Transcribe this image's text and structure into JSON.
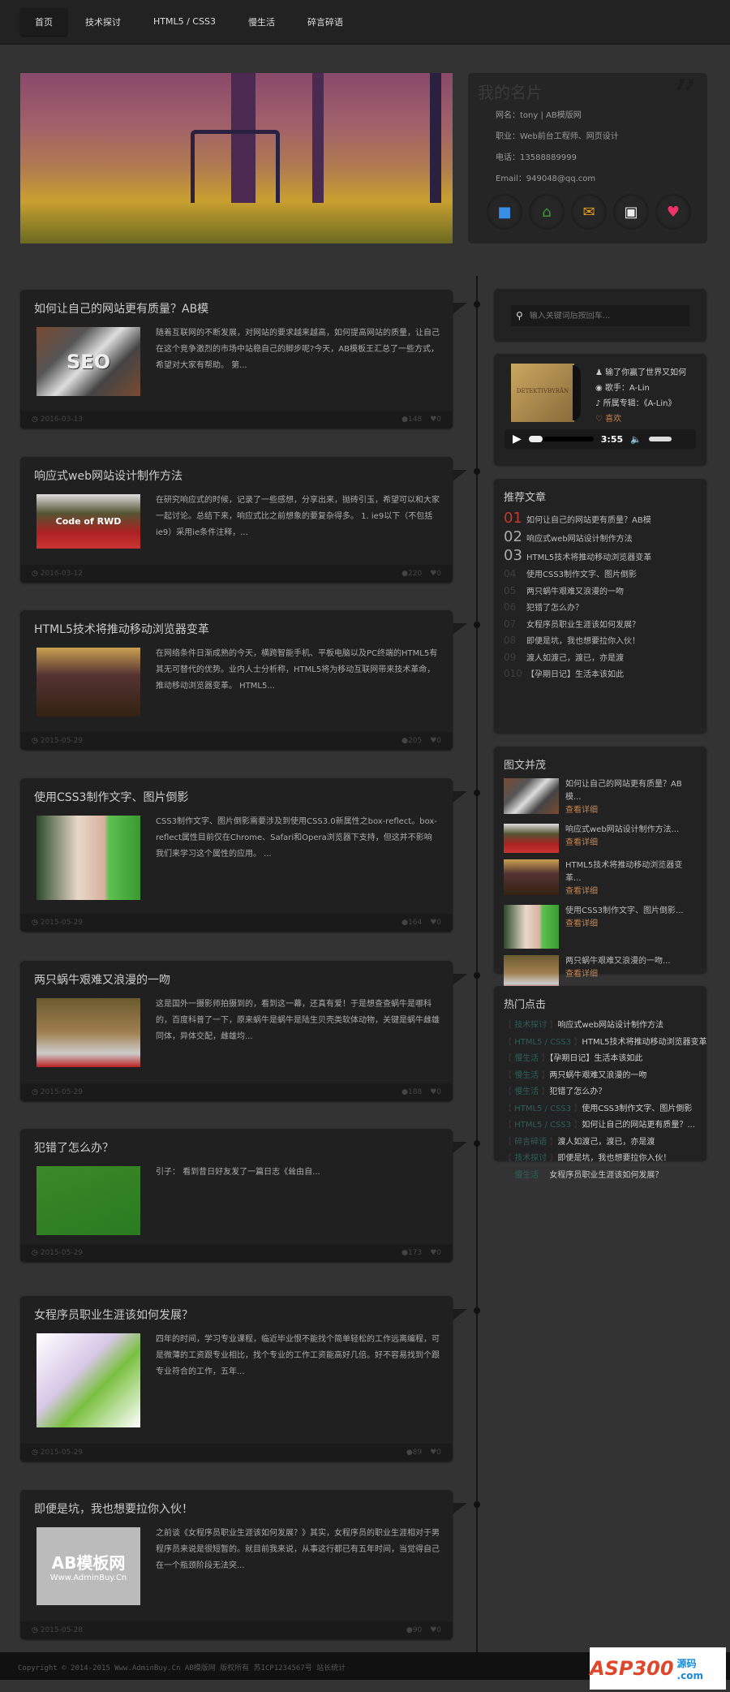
{
  "nav": {
    "items": [
      "首页",
      "技术探讨",
      "HTML5 / CSS3",
      "慢生活",
      "碎言碎语"
    ]
  },
  "profile": {
    "title": "我的名片",
    "quote": "”",
    "name": "网名：tony | AB模版网",
    "job": "职业：Web前台工程师、网页设计",
    "phone": "电话：13588889999",
    "email": "Email：949048@qq.com"
  },
  "posts": [
    {
      "title": "如何让自己的网站更有质量？AB模",
      "excerpt": "随着互联网的不断发展，对网站的要求越来越高，如何提高网站的质量，让自己在这个竞争激烈的市场中站稳自己的脚步呢?今天，AB模板王汇总了一些方式，希望对大家有帮助。 第...",
      "date": "2016-03-13",
      "comments": "148",
      "likes": "0",
      "thumb_text": "SEO"
    },
    {
      "title": "响应式web网站设计制作方法",
      "excerpt": "在研究响应式的时候，记录了一些感想，分享出来，抛砖引玉，希望可以和大家一起讨论。总结下来，响应式比之前想象的要复杂得多。 1. ie9以下（不包括ie9）采用ie条件注释，...",
      "date": "2016-03-12",
      "comments": "220",
      "likes": "0",
      "thumb_text": "Code of RWD"
    },
    {
      "title": "HTML5技术将推动移动浏览器变革",
      "excerpt": "在网络条件日渐成熟的今天，横跨智能手机、平板电脑以及PC终端的HTML5有其无可替代的优势。业内人士分析称，HTML5将为移动互联网带来技术革命，推动移动浏览器变革。 HTML5...",
      "date": "2015-05-29",
      "comments": "205",
      "likes": "0"
    },
    {
      "title": "使用CSS3制作文字、图片倒影",
      "excerpt": "CSS3制作文字、图片倒影需要涉及到使用CSS3.0新属性之box-reflect。box-reflect属性目前仅在Chrome、Safari和Opera浏览器下支持，但这并不影响我们来学习这个属性的应用。 ...",
      "date": "2015-05-29",
      "comments": "164",
      "likes": "0"
    },
    {
      "title": "两只蜗牛艰难又浪漫的一吻",
      "excerpt": "这是国外一摄影师拍摄到的，看到这一幕，还真有爱！于是想查查蜗牛是哪科的，百度科普了一下，原来蜗牛是蜗牛是陆生贝壳类软体动物，关键是蜗牛雌雄同体，异体交配，雌雄均...",
      "date": "2015-05-29",
      "comments": "188",
      "likes": "0"
    },
    {
      "title": "犯错了怎么办？",
      "excerpt": "引子： 看到昔日好友发了一篇日志《耸由自...",
      "date": "2015-05-29",
      "comments": "173",
      "likes": "0"
    },
    {
      "title": "女程序员职业生涯该如何发展？",
      "excerpt": "四年的时间，学习专业课程，临近毕业恨不能找个简单轻松的工作远离编程，可是微薄的工资跟专业相比，找个专业的工作工资能高好几倍。好不容易找到个跟专业符合的工作，五年...",
      "date": "2015-05-29",
      "comments": "89",
      "likes": "0"
    },
    {
      "title": "即便是坑，我也想要拉你入伙！",
      "excerpt": "之前谈《女程序员职业生涯该如何发展？》其实，女程序员的职业生涯相对于男程序员来说是很短暂的。就目前我来说，从事这行都已有五年时间，当觉得自己在一个瓶颈阶段无法突...",
      "date": "2015-05-28",
      "comments": "90",
      "likes": "0",
      "thumb_text": "AB模板网",
      "thumb_sub": "Www.AdminBuy.Cn"
    }
  ],
  "search": {
    "placeholder": "输入关键词后按回车..."
  },
  "player": {
    "song": "输了你赢了世界又如何",
    "singer": "歌手：A-Lin",
    "album": "所属专辑：《A-Lin》",
    "like": "喜欢",
    "time": "3:55",
    "cover_text": "DETEKTIVBYRÅN"
  },
  "recommend": {
    "title": "推荐文章",
    "items": [
      {
        "n": "01",
        "t": "如何让自己的网站更有质量？AB模"
      },
      {
        "n": "02",
        "t": "响应式web网站设计制作方法"
      },
      {
        "n": "03",
        "t": "HTML5技术将推动移动浏览器变革"
      },
      {
        "n": "04",
        "t": "使用CSS3制作文字、图片倒影"
      },
      {
        "n": "05",
        "t": "两只蜗牛艰难又浪漫的一吻"
      },
      {
        "n": "06",
        "t": "犯错了怎么办？"
      },
      {
        "n": "07",
        "t": "女程序员职业生涯该如何发展？"
      },
      {
        "n": "08",
        "t": "即便是坑，我也想要拉你入伙！"
      },
      {
        "n": "09",
        "t": "渡人如渡己，渡已，亦是渡"
      },
      {
        "n": "010",
        "t": "【孕期日记】生活本该如此"
      }
    ]
  },
  "gallery": {
    "title": "图文并茂",
    "more": "查看详细",
    "items": [
      "如何让自己的网站更有质量？AB模...",
      "响应式web网站设计制作方法...",
      "HTML5技术将推动移动浏览器变革...",
      "使用CSS3制作文字、图片倒影...",
      "两只蜗牛艰难又浪漫的一吻..."
    ]
  },
  "hot": {
    "title": "热门点击",
    "items": [
      {
        "tag": "技术探讨",
        "t": "响应式web网站设计制作方法"
      },
      {
        "tag": "HTML5 / CSS3",
        "t": "HTML5技术将推动移动浏览器变革"
      },
      {
        "tag": "慢生活",
        "t": "【孕期日记】生活本该如此"
      },
      {
        "tag": "慢生活",
        "t": "两只蜗牛艰难又浪漫的一吻"
      },
      {
        "tag": "慢生活",
        "t": "犯错了怎么办？"
      },
      {
        "tag": "HTML5 / CSS3",
        "t": "使用CSS3制作文字、图片倒影"
      },
      {
        "tag": "HTML5 / CSS3",
        "t": "如何让自己的网站更有质量？..."
      },
      {
        "tag": "碎言碎语",
        "t": "渡人如渡己，渡已，亦是渡"
      },
      {
        "tag": "技术探讨",
        "t": "即便是坑，我也想要拉你入伙！"
      },
      {
        "tag": "慢生活",
        "t": "女程序员职业生涯该如何发展？"
      }
    ]
  },
  "footer": {
    "copyright": "Copyright © 2014-2015 Www.AdminBuy.Cn AB模版网 版权所有 苏ICP1234567号 站长统计"
  },
  "watermark": {
    "text": "ASP300",
    "sub": "源码 .com"
  }
}
